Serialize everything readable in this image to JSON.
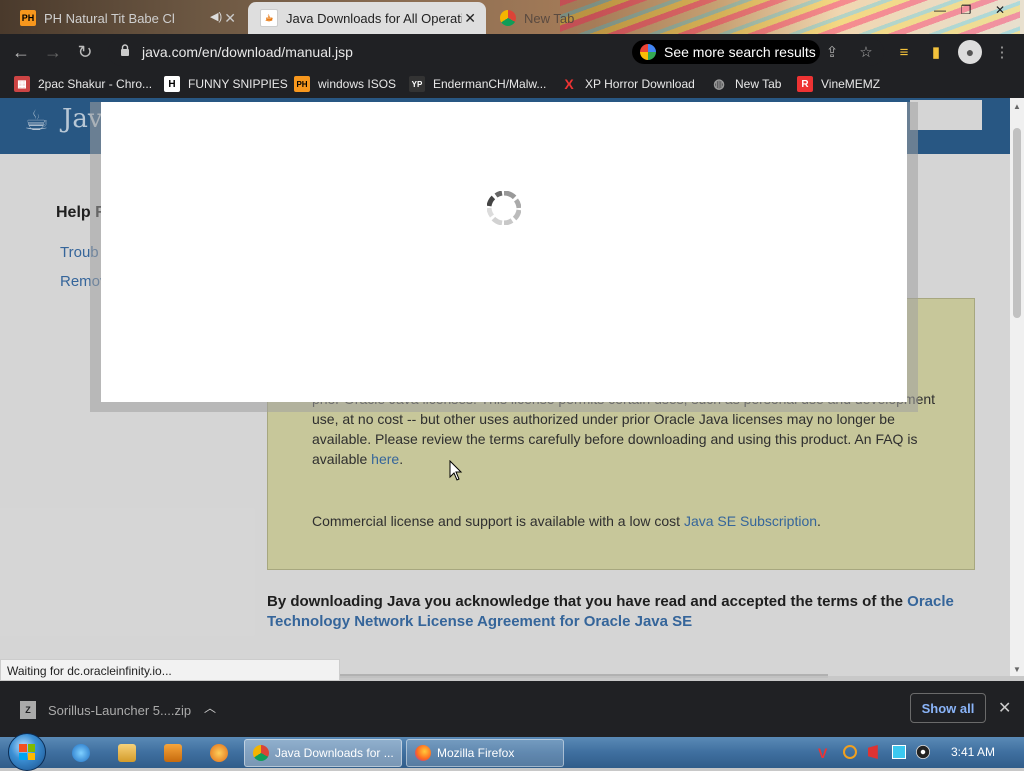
{
  "browser": {
    "tabs": [
      {
        "favicon": "PH",
        "title": "PH Natural Tit Babe Ch",
        "active": false
      },
      {
        "favicon": "java-icon",
        "title": "Java Downloads for All Operatin",
        "active": true
      },
      {
        "favicon": "chrome-icon",
        "title": "New Tab",
        "active": false
      }
    ],
    "url": "java.com/en/download/manual.jsp",
    "search_pill": "See more search results"
  },
  "bookmarks": [
    {
      "icon": "calendar-icon",
      "label": "2pac Shakur - Chro..."
    },
    {
      "icon": "H",
      "label": "FUNNY SNIPPIES"
    },
    {
      "icon": "PH",
      "label": "windows ISOS"
    },
    {
      "icon": "YP",
      "label": "EndermanCH/Malw..."
    },
    {
      "icon": "X",
      "label": "XP Horror Download"
    },
    {
      "icon": "globe-icon",
      "label": "New Tab"
    },
    {
      "icon": "R",
      "label": "VineMEMZ"
    }
  ],
  "page": {
    "brand": "Java",
    "sidebar": {
      "heading": "Help R",
      "links": [
        "Troub",
        "Remov"
      ]
    },
    "notice": {
      "p1_start": "prior Oracle Java licenses. This license permits certain uses, such as personal use and development use, at no cost -- but other uses authorized under prior Oracle Java licenses may no longer be available. Please review the terms carefully before downloading and using this product. An FAQ is available ",
      "p1_link": "here",
      "p1_end": ".",
      "p2_start": "Commercial license and support is available with a low cost ",
      "p2_link": "Java SE Subscription",
      "p2_end": "."
    },
    "ack_start": "By downloading Java you acknowledge that you have read and accepted the terms of the ",
    "ack_link": "Oracle Technology Network License Agreement for Oracle Java SE"
  },
  "status": "Waiting for dc.oracleinfinity.io...",
  "downloads": {
    "file": "Sorillus-Launcher 5....zip",
    "show_all": "Show all"
  },
  "taskbar": {
    "tasks": [
      {
        "label": "Java Downloads for ...",
        "active": true
      },
      {
        "label": "Mozilla Firefox",
        "active": false
      }
    ],
    "clock": "3:41 AM"
  },
  "colors": {
    "chrome_dark": "#202124",
    "java_blue": "#2c5f8f",
    "link_blue": "#3a6ea8",
    "notice_bg": "#d8d8a8",
    "show_all": "#8ab4f8"
  }
}
